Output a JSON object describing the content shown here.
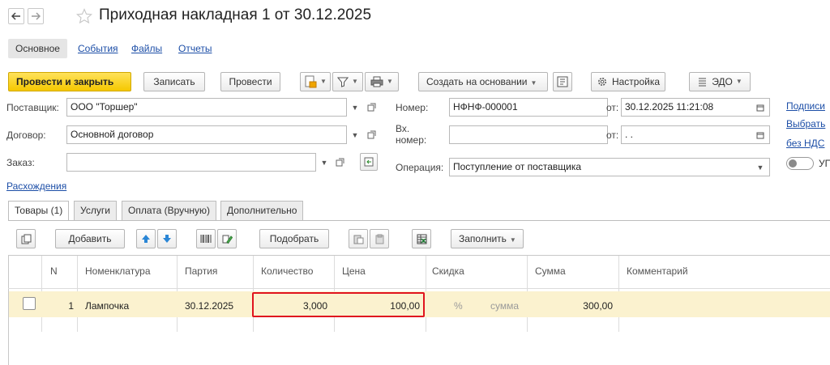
{
  "window": {
    "title": "Приходная накладная 1 от 30.12.2025"
  },
  "nav_tabs": [
    "Основное",
    "События",
    "Файлы",
    "Отчеты"
  ],
  "toolbar": {
    "post_close_label": "Провести и закрыть",
    "save_label": "Записать",
    "post_label": "Провести",
    "create_based_label": "Создать на основании",
    "settings_label": "Настройка",
    "edo_label": "ЭДО"
  },
  "form": {
    "supplier_label": "Поставщик:",
    "supplier_value": "ООО \"Торшер\"",
    "contract_label": "Договор:",
    "contract_value": "Основной договор",
    "order_label": "Заказ:",
    "order_value": "",
    "number_label": "Номер:",
    "number_value": "НФНФ-000001",
    "from_label": "от:",
    "date_value": "30.12.2025 11:21:08",
    "in_number_label_1": "Вх.",
    "in_number_label_2": "номер:",
    "in_number_value": "",
    "in_from_label": "от:",
    "in_date_value": " .  .",
    "operation_label": "Операция:",
    "operation_value": "Поступление от поставщика",
    "discrepancies_link": "Расхождения"
  },
  "right_links": {
    "signatures": "Подписи",
    "choose": "Выбрать",
    "vat": "без НДС",
    "toggle_label": "УП",
    "toggle_on": false
  },
  "inner_tabs": [
    "Товары (1)",
    "Услуги",
    "Оплата (Вручную)",
    "Дополнительно"
  ],
  "table_toolbar": {
    "add_label": "Добавить",
    "pick_label": "Подобрать",
    "fill_label": "Заполнить"
  },
  "table": {
    "columns": [
      "N",
      "Номенклатура",
      "Партия",
      "Количество",
      "Цена",
      "Скидка",
      "Сумма",
      "Комментарий"
    ],
    "rows": [
      {
        "n": "1",
        "item": "Лампочка",
        "batch": "30.12.2025",
        "quantity": "3,000",
        "price": "100,00",
        "discount_percent": "%",
        "discount_sum": "сумма",
        "sum": "300,00",
        "comment": ""
      }
    ]
  },
  "colors": {
    "accent_yellow": "#f5c800",
    "row_highlight": "#fbf2cf",
    "highlight_border": "#e0141e",
    "link_blue": "#1c4ea7"
  }
}
